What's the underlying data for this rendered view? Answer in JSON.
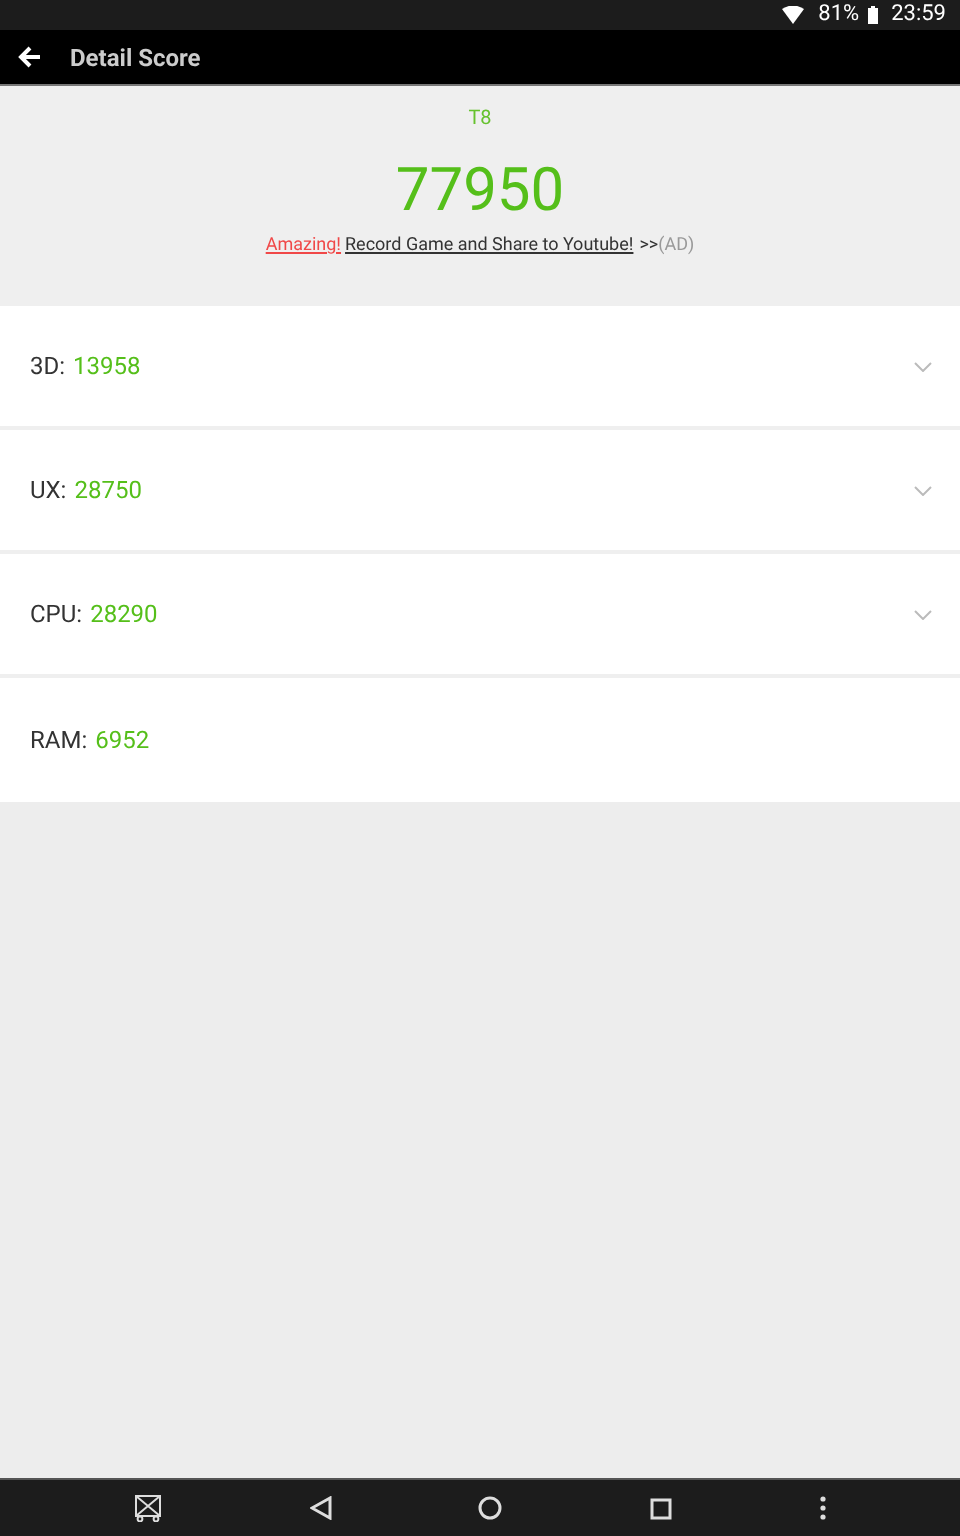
{
  "status_bar": {
    "battery": "81%",
    "time": "23:59"
  },
  "app_bar": {
    "title": "Detail Score"
  },
  "device": "T8",
  "total_score": "77950",
  "promo": {
    "highlight": "Amazing!",
    "link": "Record Game and Share to Youtube!",
    "arrows": ">>",
    "tag": "(AD)"
  },
  "scores": [
    {
      "label": "3D:",
      "value": "13958",
      "expandable": true
    },
    {
      "label": "UX:",
      "value": "28750",
      "expandable": true
    },
    {
      "label": "CPU:",
      "value": "28290",
      "expandable": true
    },
    {
      "label": "RAM:",
      "value": "6952",
      "expandable": false
    }
  ]
}
